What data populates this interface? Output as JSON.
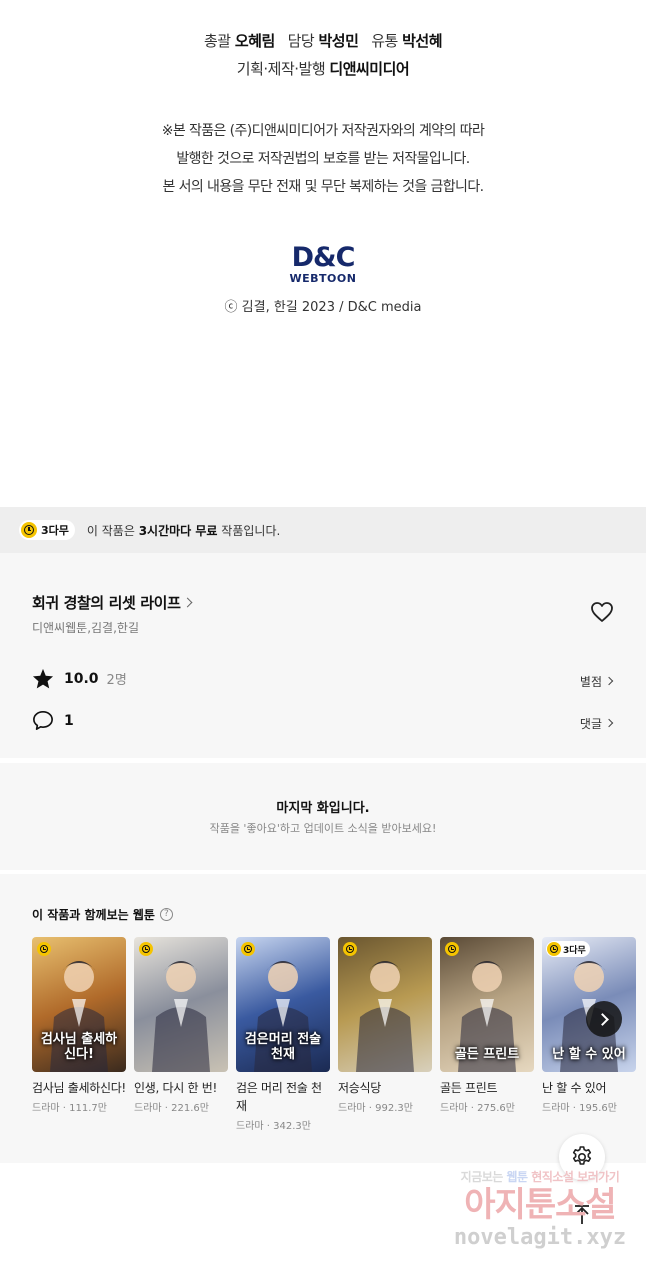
{
  "credits": {
    "line1_parts": [
      {
        "label": "총괄",
        "value": "오혜림"
      },
      {
        "label": "담당",
        "value": "박성민"
      },
      {
        "label": "유통",
        "value": "박선혜"
      }
    ],
    "line2_label": "기획·제작·발행",
    "line2_value": "디앤씨미디어",
    "notice": [
      "※본 작품은 (주)디앤씨미디어가 저작권자와의 계약의 따라",
      "발행한 것으로 저작권법의 보호를 받는 저작물입니다.",
      "본 서의 내용을 무단 전재 및 무단 복제하는 것을 금합니다."
    ],
    "logo_top": "D&C",
    "logo_bottom": "WEBTOON",
    "copyright": "ⓒ 김결, 한길 2023 / D&C media"
  },
  "free_bar": {
    "badge": "3다무",
    "text_pre": "이 작품은 ",
    "text_bold": "3시간마다 무료",
    "text_post": " 작품입니다."
  },
  "work": {
    "title": "회귀 경찰의 리셋 라이프",
    "authors": "디앤씨웹툰,김결,한길",
    "rating": "10.0",
    "rating_count": "2명",
    "rating_link": "별점",
    "comments": "1",
    "comments_link": "댓글"
  },
  "last_episode": {
    "title": "마지막 화입니다.",
    "subtitle": "작품을 '좋아요'하고 업데이트 소식을 받아보세요!"
  },
  "recommendations": {
    "heading": "이 작품과 함께보는 웹툰",
    "help_glyph": "?",
    "items": [
      {
        "name": "검사님 출세하신다!",
        "genre": "드라마",
        "views": "111.7만",
        "thumb_text": "검사님 출세하신다!",
        "badge": "clock",
        "colors": [
          "#3a2a1e",
          "#b06a2a",
          "#e8c070"
        ]
      },
      {
        "name": "인생, 다시 한 번!",
        "genre": "드라마",
        "views": "221.6만",
        "thumb_text": "",
        "badge": "clock",
        "colors": [
          "#c9c2b4",
          "#8a8f9c",
          "#e8e4dc"
        ]
      },
      {
        "name": "검은 머리 전술 천재",
        "genre": "드라마",
        "views": "342.3만",
        "thumb_text": "검은머리 전술천재",
        "badge": "clock",
        "colors": [
          "#1b2a52",
          "#3a5aa0",
          "#c8d6f0"
        ]
      },
      {
        "name": "저승식당",
        "genre": "드라마",
        "views": "992.3만",
        "thumb_text": "",
        "badge": "clock",
        "colors": [
          "#d8d0bc",
          "#b89a52",
          "#6a5630"
        ]
      },
      {
        "name": "골든 프린트",
        "genre": "드라마",
        "views": "275.6만",
        "thumb_text": "골든 프린트",
        "badge": "clock",
        "colors": [
          "#e6d8c0",
          "#b8a484",
          "#5a4a36"
        ]
      },
      {
        "name": "난 할 수 있어",
        "genre": "드라마",
        "views": "195.6만",
        "thumb_text": "난 할 수 있어",
        "badge": "3다무",
        "colors": [
          "#c8d4ec",
          "#7a8cb8",
          "#e8ecf6"
        ]
      }
    ]
  },
  "watermark": {
    "line1_a": "지금보는",
    "line1_b": "웹툰",
    "line1_c": "현직소설",
    "line1_d": "보러가기",
    "line2": "아지툰소설",
    "line3": "novelagit.xyz"
  }
}
